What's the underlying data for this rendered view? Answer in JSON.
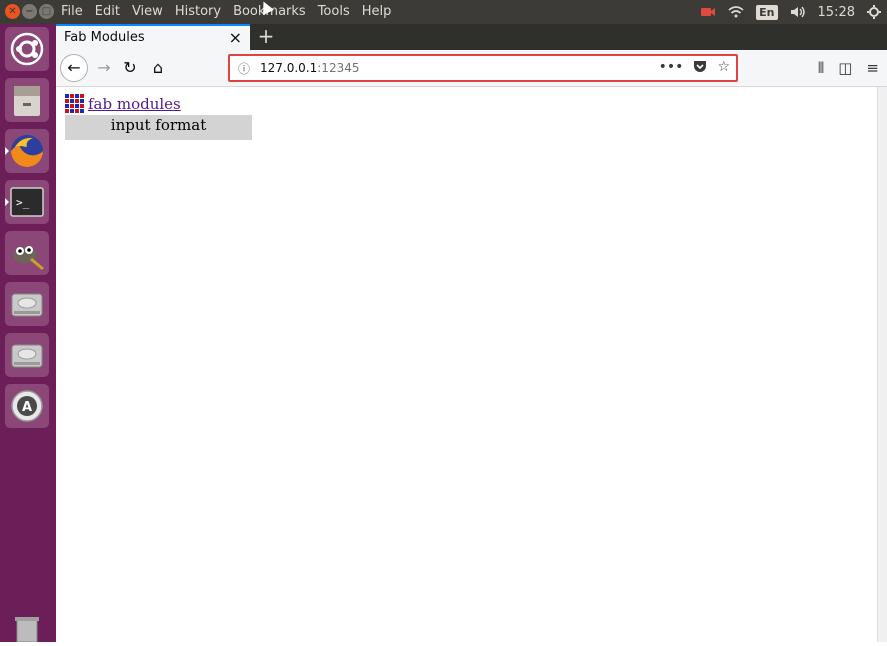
{
  "menubar": {
    "items": [
      "File",
      "Edit",
      "View",
      "History",
      "Bookmarks",
      "Tools",
      "Help"
    ],
    "tray": {
      "keyboard": "En",
      "time": "15:28"
    }
  },
  "launcher": {
    "items": [
      "ubuntu",
      "files",
      "firefox",
      "terminal",
      "gimp",
      "disk",
      "disk",
      "software-updater",
      "trash"
    ]
  },
  "browser": {
    "tab_title": "Fab Modules",
    "new_tab_label": "+",
    "url_host": "127.0.0.1",
    "url_port": ":12345",
    "accent_color": "#0a84ff",
    "highlight_color": "#e04343"
  },
  "page": {
    "link_text": "fab modules",
    "input_format_label": "input format"
  }
}
